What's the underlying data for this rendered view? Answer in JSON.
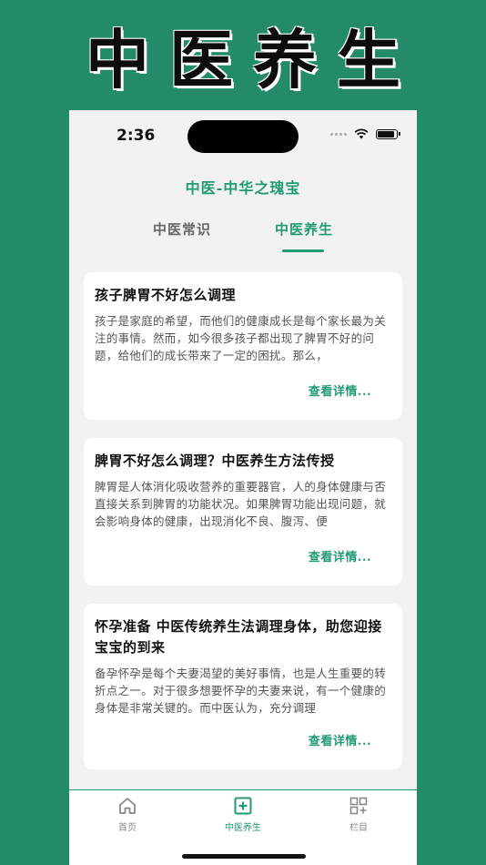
{
  "banner": {
    "title": "中医养生"
  },
  "status_bar": {
    "time": "2:36"
  },
  "header": {
    "title": "中医-中华之瑰宝"
  },
  "tabs": [
    {
      "label": "中医常识",
      "active": false
    },
    {
      "label": "中医养生",
      "active": true
    }
  ],
  "articles": [
    {
      "title": "孩子脾胃不好怎么调理",
      "excerpt": "孩子是家庭的希望，而他们的健康成长是每个家长最为关注的事情。然而，如今很多孩子都出现了脾胃不好的问题，给他们的成长带来了一定的困扰。那么，",
      "link": "查看详情..."
    },
    {
      "title": "脾胃不好怎么调理？中医养生方法传授",
      "excerpt": "脾胃是人体消化吸收营养的重要器官，人的身体健康与否直接关系到脾胃的功能状况。如果脾胃功能出现问题，就会影响身体的健康，出现消化不良、腹泻、便",
      "link": "查看详情..."
    },
    {
      "title": "怀孕准备 中医传统养生法调理身体，助您迎接宝宝的到来",
      "excerpt": "备孕怀孕是每个夫妻渴望的美好事情，也是人生重要的转折点之一。对于很多想要怀孕的夫妻来说，有一个健康的身体是非常关键的。而中医认为，充分调理",
      "link": "查看详情..."
    }
  ],
  "tabbar": [
    {
      "label": "首页",
      "icon": "home-icon",
      "active": false
    },
    {
      "label": "中医养生",
      "icon": "plus-square-icon",
      "active": true
    },
    {
      "label": "栏目",
      "icon": "grid-add-icon",
      "active": false
    }
  ],
  "colors": {
    "brand": "#239a76",
    "background": "#238a6a"
  }
}
